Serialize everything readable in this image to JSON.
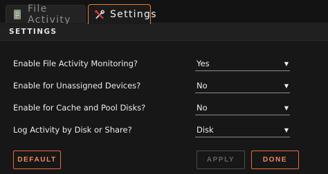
{
  "tabs": [
    {
      "label": "File Activity",
      "icon": "document-icon",
      "active": false
    },
    {
      "label": "Settings",
      "icon": "tools-icon",
      "active": true
    }
  ],
  "section": {
    "title": "SETTINGS"
  },
  "settings": [
    {
      "label": "Enable File Activity Monitoring?",
      "value": "Yes"
    },
    {
      "label": "Enable for Unassigned Devices?",
      "value": "No"
    },
    {
      "label": "Enable for Cache and Pool Disks?",
      "value": "No"
    },
    {
      "label": "Log Activity by Disk or Share?",
      "value": "Disk"
    }
  ],
  "buttons": {
    "default_label": "DEFAULT",
    "apply_label": "APPLY",
    "done_label": "DONE"
  },
  "colors": {
    "accent": "#f07c25",
    "button_accent": "#ee6a3a",
    "background": "#171717"
  },
  "select_caret": "▼"
}
